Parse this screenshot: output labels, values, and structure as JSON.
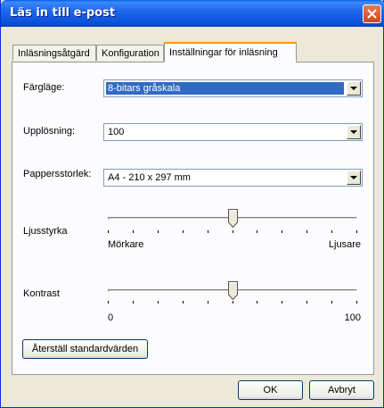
{
  "window": {
    "title": "Läs in till e-post"
  },
  "tabs": [
    {
      "label": "Inläsningsåtgärd"
    },
    {
      "label": "Konfiguration"
    },
    {
      "label": "Inställningar för inläsning"
    }
  ],
  "settings": {
    "color_mode": {
      "label": "Färgläge:",
      "value": "8-bitars gråskala"
    },
    "resolution": {
      "label": "Upplösning:",
      "value": "100"
    },
    "paper_size": {
      "label": "Pappersstorlek:",
      "value": "A4 - 210 x 297 mm"
    },
    "brightness": {
      "label": "Ljusstyrka",
      "min_label": "Mörkare",
      "max_label": "Ljusare",
      "level": 0.5
    },
    "contrast": {
      "label": "Kontrast",
      "min_label": "0",
      "max_label": "100",
      "level": 0.5
    },
    "reset_label": "Återställ standardvärden"
  },
  "footer": {
    "ok_label": "OK",
    "cancel_label": "Avbryt"
  },
  "icons": {
    "close": "close-icon",
    "dropdown": "dropdown-arrow-icon",
    "slider": "slider-thumb-icon"
  }
}
